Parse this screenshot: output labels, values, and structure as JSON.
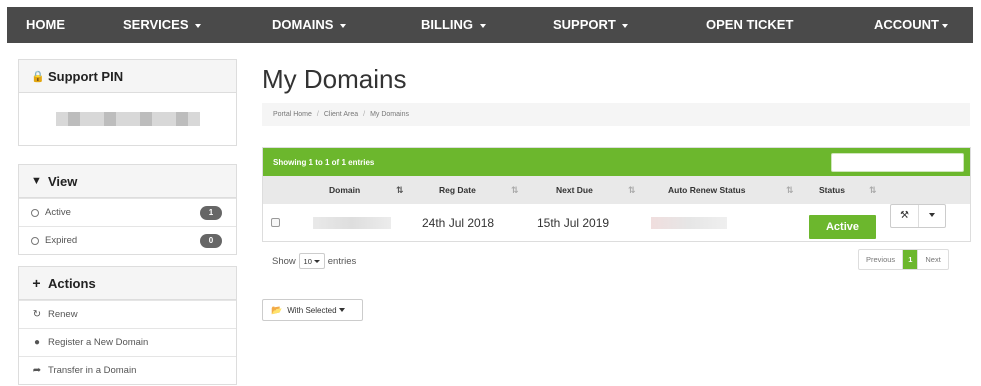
{
  "nav": {
    "home": "HOME",
    "services": "SERVICES",
    "domains": "DOMAINS",
    "billing": "BILLING",
    "support": "SUPPORT",
    "open_ticket": "OPEN TICKET",
    "account": "ACCOUNT"
  },
  "sidebar": {
    "support_pin": {
      "title": "Support PIN"
    },
    "view": {
      "title": "View",
      "items": [
        {
          "label": "Active",
          "count": "1"
        },
        {
          "label": "Expired",
          "count": "0"
        }
      ]
    },
    "actions": {
      "title": "Actions",
      "items": [
        {
          "label": "Renew",
          "icon": "refresh-icon"
        },
        {
          "label": "Register a New Domain",
          "icon": "globe-icon"
        },
        {
          "label": "Transfer in a Domain",
          "icon": "share-arrow-icon"
        }
      ]
    }
  },
  "main": {
    "title": "My Domains",
    "breadcrumb": [
      "Portal Home",
      "Client Area",
      "My Domains"
    ],
    "table_info": "Showing 1 to 1 of 1 entries",
    "columns": [
      "Domain",
      "Reg Date",
      "Next Due",
      "Auto Renew Status",
      "Status"
    ],
    "rows": [
      {
        "reg_date": "24th Jul 2018",
        "next_due": "15th Jul 2019",
        "status": "Active"
      }
    ],
    "show_label": "Show",
    "entries_value": "10",
    "entries_label": "entries",
    "pagination": {
      "previous": "Previous",
      "current": "1",
      "next": "Next"
    },
    "with_selected": "With Selected"
  },
  "colors": {
    "nav_bg": "#4a4a4a",
    "accent_green": "#6cb72d",
    "panel_header_bg": "#f5f5f5"
  }
}
